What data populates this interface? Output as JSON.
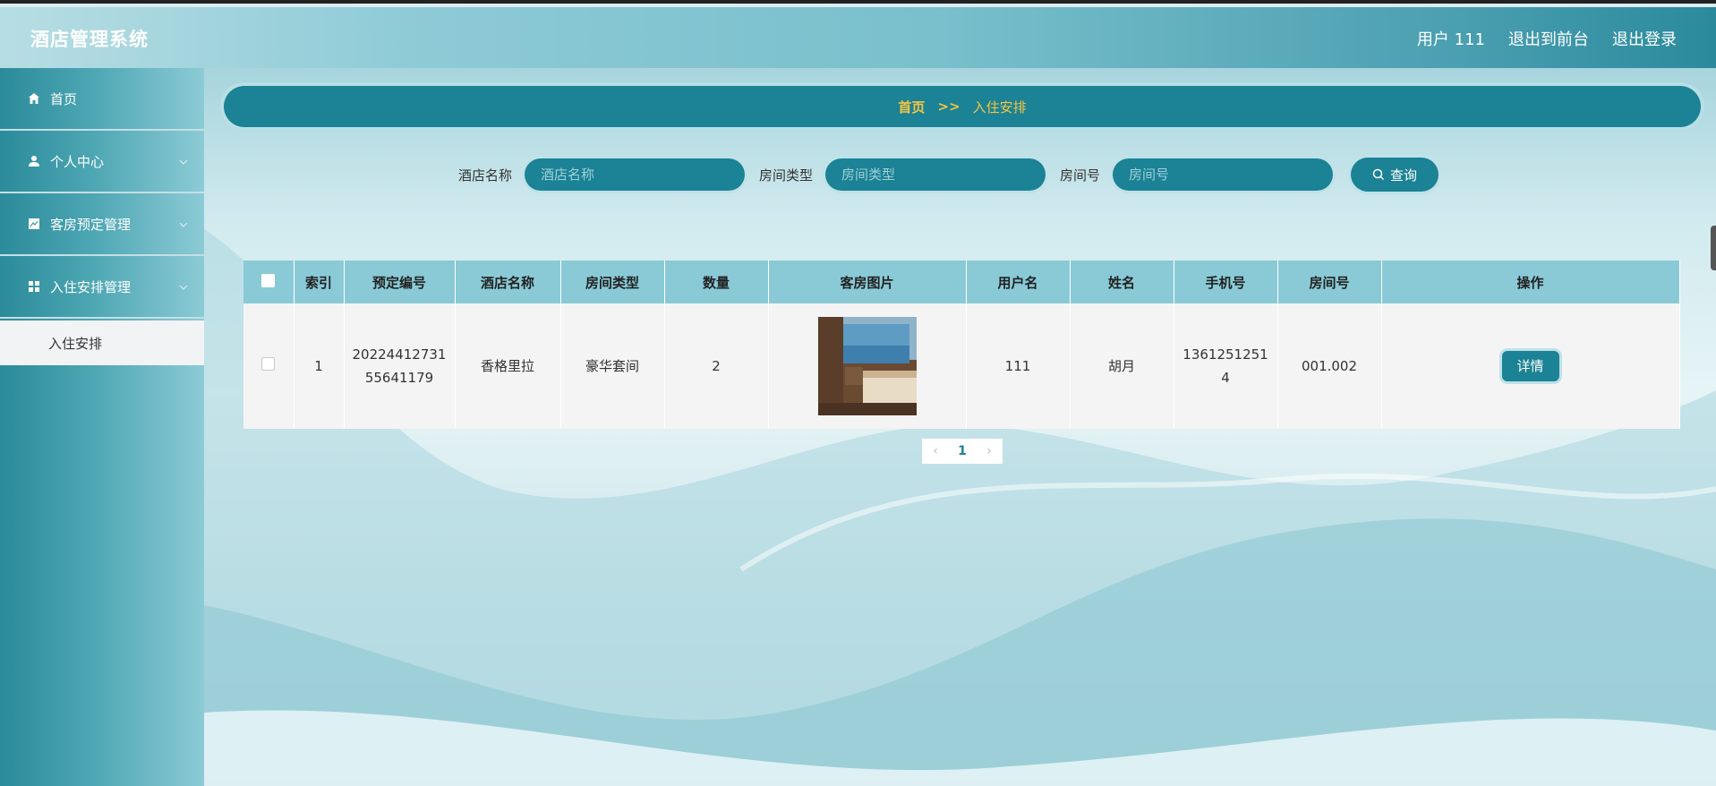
{
  "header": {
    "app_title": "酒店管理系统",
    "user_label": "用户 111",
    "back_to_front": "退出到前台",
    "logout": "退出登录"
  },
  "sidebar": {
    "items": [
      {
        "label": "首页",
        "icon": "home-icon"
      },
      {
        "label": "个人中心",
        "icon": "user-icon"
      },
      {
        "label": "客房预定管理",
        "icon": "chart-icon"
      },
      {
        "label": "入住安排管理",
        "icon": "grid-icon"
      }
    ],
    "active_sub": "入住安排"
  },
  "breadcrumb": {
    "home": "首页",
    "sep": ">>",
    "current": "入住安排"
  },
  "search": {
    "hotel_label": "酒店名称",
    "hotel_placeholder": "酒店名称",
    "type_label": "房间类型",
    "type_placeholder": "房间类型",
    "room_label": "房间号",
    "room_placeholder": "房间号",
    "button": "查询"
  },
  "table": {
    "headers": [
      "索引",
      "预定编号",
      "酒店名称",
      "房间类型",
      "数量",
      "客房图片",
      "用户名",
      "姓名",
      "手机号",
      "房间号",
      "操作"
    ],
    "rows": [
      {
        "index": "1",
        "order_no_1": "20224412731",
        "order_no_2": "55641179",
        "hotel": "香格里拉",
        "room_type": "豪华套间",
        "quantity": "2",
        "username": "111",
        "name": "胡月",
        "phone_1": "1361251251",
        "phone_2": "4",
        "room_no": "001.002",
        "action": "详情"
      }
    ]
  },
  "pager": {
    "prev": "‹",
    "page": "1",
    "next": "›"
  },
  "colors": {
    "primary": "#1c8295",
    "accent": "#f5c542",
    "header_row": "#8acad7"
  }
}
